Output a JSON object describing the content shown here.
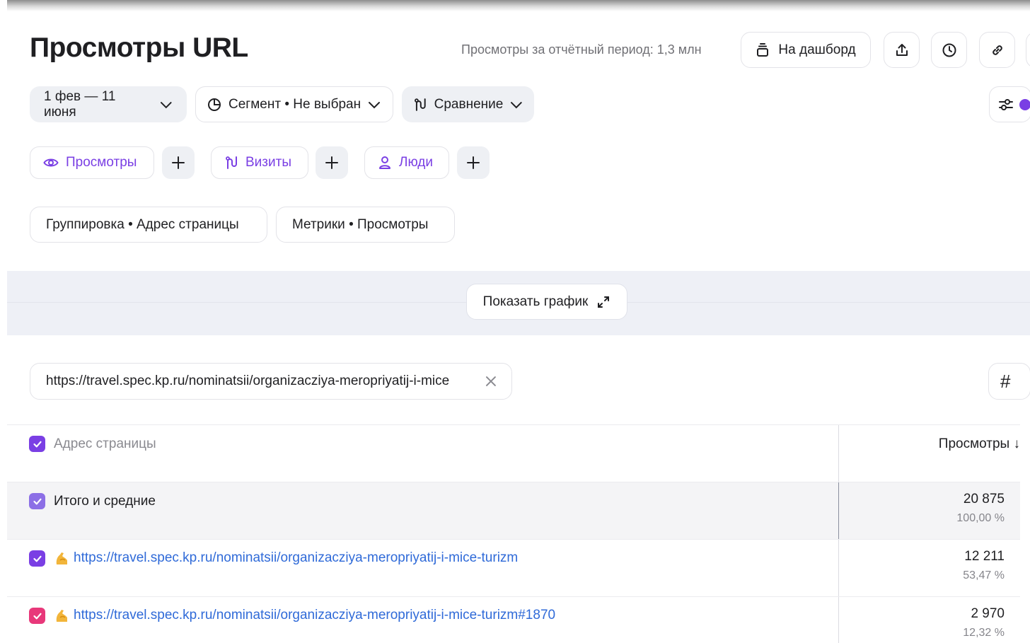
{
  "header": {
    "title": "Просмотры URL",
    "period_text": "Просмотры за отчётный период: 1,3 млн",
    "dashboard_label": "На дашборд"
  },
  "filters": {
    "date_label": "1 фев — 11 июня",
    "segment_label": "Сегмент • Не выбран",
    "compare_label": "Сравнение"
  },
  "metrics": [
    {
      "label": "Просмотры"
    },
    {
      "label": "Визиты"
    },
    {
      "label": "Люди"
    }
  ],
  "grouping": {
    "group_label": "Группировка • Адрес страницы",
    "metrics_label": "Метрики • Просмотры"
  },
  "chart_toggle": {
    "label": "Показать график"
  },
  "search": {
    "value": "https://travel.spec.kp.ru/nominatsii/organizaczi​ya-meropriyatij-i-mice"
  },
  "table": {
    "headers": {
      "dimension": "Адрес страницы",
      "metric": "Просмотры ↓"
    },
    "total": {
      "label": "Итого и средние",
      "value": "20 875",
      "percent": "100,00 %"
    },
    "rows": [
      {
        "url": "https://travel.spec.kp.ru/nominatsii/organizacziya-meropriyatij-i-mice-turizm",
        "value": "12 211",
        "percent": "53,47 %",
        "checkbox_color": "#7a3fe4"
      },
      {
        "url": "https://travel.spec.kp.ru/nominatsii/organizacziya-meropriyatij-i-mice-turizm#1870",
        "value": "2 970",
        "percent": "12,32 %",
        "checkbox_color": "#e8387a"
      }
    ]
  },
  "colors": {
    "accent": "#7a3fe4",
    "link": "#2f6ad8",
    "second_series": "#e8387a"
  }
}
